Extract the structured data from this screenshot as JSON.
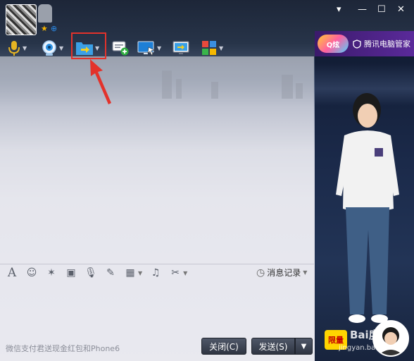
{
  "window": {
    "controls": {
      "collapse": "▾",
      "minimize": "—",
      "maximize": "☐",
      "close": "✕"
    }
  },
  "toolbar": {
    "items": [
      {
        "name": "voice-call",
        "icon": "microphone-icon"
      },
      {
        "name": "video-call",
        "icon": "camera-icon"
      },
      {
        "name": "send-file",
        "icon": "folder-arrow-icon"
      },
      {
        "name": "new-discussion",
        "icon": "chat-plus-icon"
      },
      {
        "name": "remote-desktop",
        "icon": "monitor-cursor-icon"
      },
      {
        "name": "share-screen",
        "icon": "screen-share-icon"
      },
      {
        "name": "apps",
        "icon": "apps-grid-icon"
      }
    ],
    "highlight_color": "#e3322b"
  },
  "ad": {
    "logo_text": "Q炫",
    "security_label": "腾讯电脑管家",
    "badge_label": "限量",
    "watermark": "Bai度",
    "watermark_sub": "jingyan.baidu.com"
  },
  "input_toolbar": {
    "items": [
      "font-icon",
      "emoji-icon",
      "shake-icon",
      "gif-icon",
      "voice-msg-icon",
      "edit-icon",
      "image-icon",
      "music-icon",
      "scissors-icon"
    ],
    "history_label": "消息记录"
  },
  "footer": {
    "promo_text": "微信支付君送现金红包和Phone6",
    "close_label": "关闭(C)",
    "send_label": "发送(S)"
  }
}
